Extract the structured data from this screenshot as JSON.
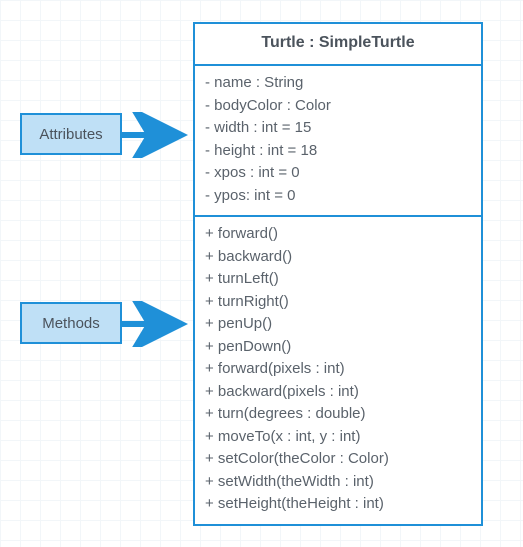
{
  "uml": {
    "title": "Turtle : SimpleTurtle",
    "attributes": [
      "- name : String",
      "- bodyColor : Color",
      "- width : int = 15",
      "- height : int = 18",
      "- xpos : int = 0",
      "- ypos: int = 0"
    ],
    "methods": [
      "+ forward()",
      "+ backward()",
      "+ turnLeft()",
      "+ turnRight()",
      "+ penUp()",
      "+ penDown()",
      "+ forward(pixels : int)",
      "+ backward(pixels : int)",
      "+ turn(degrees : double)",
      "+ moveTo(x : int, y : int)",
      "+ setColor(theColor : Color)",
      "+ setWidth(theWidth : int)",
      "+ setHeight(theHeight : int)"
    ]
  },
  "labels": {
    "attributes": "Attributes",
    "methods": "Methods"
  },
  "chart_data": {
    "type": "table",
    "title": "UML class diagram: Turtle (subclass of SimpleTurtle)",
    "class_name": "Turtle",
    "superclass": "SimpleTurtle",
    "attributes": [
      {
        "visibility": "private",
        "name": "name",
        "type": "String"
      },
      {
        "visibility": "private",
        "name": "bodyColor",
        "type": "Color"
      },
      {
        "visibility": "private",
        "name": "width",
        "type": "int",
        "default": 15
      },
      {
        "visibility": "private",
        "name": "height",
        "type": "int",
        "default": 18
      },
      {
        "visibility": "private",
        "name": "xpos",
        "type": "int",
        "default": 0
      },
      {
        "visibility": "private",
        "name": "ypos",
        "type": "int",
        "default": 0
      }
    ],
    "methods": [
      {
        "visibility": "public",
        "name": "forward",
        "params": []
      },
      {
        "visibility": "public",
        "name": "backward",
        "params": []
      },
      {
        "visibility": "public",
        "name": "turnLeft",
        "params": []
      },
      {
        "visibility": "public",
        "name": "turnRight",
        "params": []
      },
      {
        "visibility": "public",
        "name": "penUp",
        "params": []
      },
      {
        "visibility": "public",
        "name": "penDown",
        "params": []
      },
      {
        "visibility": "public",
        "name": "forward",
        "params": [
          {
            "name": "pixels",
            "type": "int"
          }
        ]
      },
      {
        "visibility": "public",
        "name": "backward",
        "params": [
          {
            "name": "pixels",
            "type": "int"
          }
        ]
      },
      {
        "visibility": "public",
        "name": "turn",
        "params": [
          {
            "name": "degrees",
            "type": "double"
          }
        ]
      },
      {
        "visibility": "public",
        "name": "moveTo",
        "params": [
          {
            "name": "x",
            "type": "int"
          },
          {
            "name": "y",
            "type": "int"
          }
        ]
      },
      {
        "visibility": "public",
        "name": "setColor",
        "params": [
          {
            "name": "theColor",
            "type": "Color"
          }
        ]
      },
      {
        "visibility": "public",
        "name": "setWidth",
        "params": [
          {
            "name": "theWidth",
            "type": "int"
          }
        ]
      },
      {
        "visibility": "public",
        "name": "setHeight",
        "params": [
          {
            "name": "theHeight",
            "type": "int"
          }
        ]
      }
    ]
  }
}
